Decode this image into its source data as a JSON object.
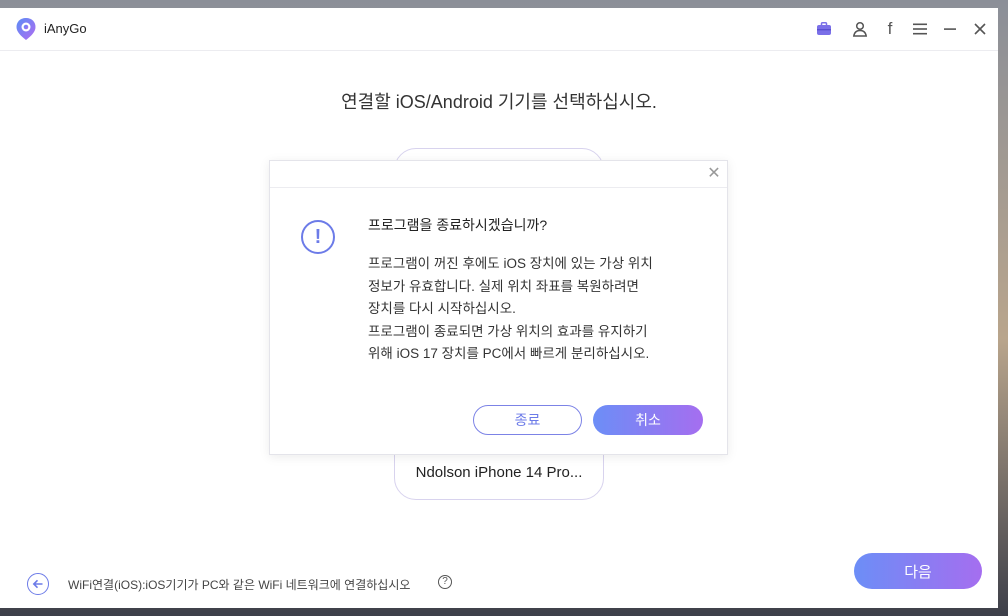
{
  "app": {
    "name": "iAnyGo"
  },
  "titlebar": {
    "icons": [
      "toolbox-icon",
      "user-icon",
      "facebook-icon",
      "menu-icon",
      "minimize-icon",
      "close-icon"
    ],
    "facebook_glyph": "f"
  },
  "main": {
    "heading": "연결할 iOS/Android 기기를 선택하십시오.",
    "device_name": "Ndolson iPhone 14 Pro..."
  },
  "footer": {
    "hint": "WiFi연결(iOS):iOS기기가 PC와 같은 WiFi 네트워크에 연결하십시오",
    "help_glyph": "?",
    "next_label": "다음"
  },
  "dialog": {
    "close_glyph": "✕",
    "alert_glyph": "!",
    "title": "프로그램을 종료하시겠습니까?",
    "body_lines": [
      "프로그램이 꺼진 후에도 iOS 장치에 있는 가상 위치",
      "정보가 유효합니다. 실제 위치 좌표를 복원하려면",
      "장치를 다시 시작하십시오.",
      "프로그램이 종료되면 가상 위치의 효과를 유지하기",
      "위해 iOS 17 장치를 PC에서 빠르게 분리하십시오."
    ],
    "quit_label": "종료",
    "cancel_label": "취소"
  },
  "colors": {
    "accent": "#6c7be8",
    "gradient_start": "#6c8ef7",
    "gradient_end": "#a56ef0"
  }
}
